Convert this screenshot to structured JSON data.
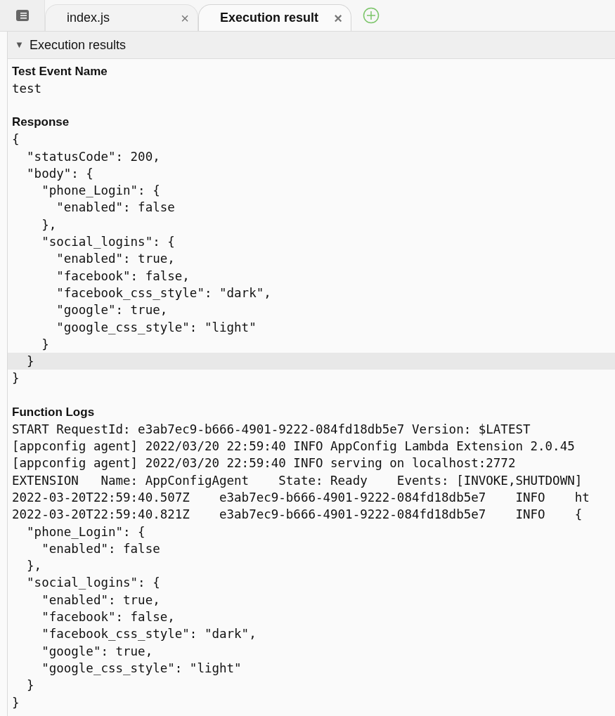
{
  "tabs": [
    {
      "label": "index.js",
      "selected": false,
      "close": "×"
    },
    {
      "label": "Execution result",
      "selected": true,
      "close": "×"
    }
  ],
  "panel": {
    "arrow": "▼",
    "title": "Execution results",
    "expanded": true
  },
  "sections": [
    {
      "heading": "Test Event Name",
      "lines": [
        {
          "text": "test",
          "current": false
        }
      ]
    },
    {
      "heading": "Response",
      "lines": [
        {
          "text": "{",
          "current": false
        },
        {
          "text": "  \"statusCode\": 200,",
          "current": false
        },
        {
          "text": "  \"body\": {",
          "current": false
        },
        {
          "text": "    \"phone_Login\": {",
          "current": false
        },
        {
          "text": "      \"enabled\": false",
          "current": false
        },
        {
          "text": "    },",
          "current": false
        },
        {
          "text": "    \"social_logins\": {",
          "current": false
        },
        {
          "text": "      \"enabled\": true,",
          "current": false
        },
        {
          "text": "      \"facebook\": false,",
          "current": false
        },
        {
          "text": "      \"facebook_css_style\": \"dark\",",
          "current": false
        },
        {
          "text": "      \"google\": true,",
          "current": false
        },
        {
          "text": "      \"google_css_style\": \"light\"",
          "current": false
        },
        {
          "text": "    }",
          "current": false
        },
        {
          "text": "  }",
          "current": true
        },
        {
          "text": "}",
          "current": false
        }
      ]
    },
    {
      "heading": "Function Logs",
      "lines": [
        {
          "text": "START RequestId: e3ab7ec9-b666-4901-9222-084fd18db5e7 Version: $LATEST",
          "current": false
        },
        {
          "text": "[appconfig agent] 2022/03/20 22:59:40 INFO AppConfig Lambda Extension 2.0.45",
          "current": false
        },
        {
          "text": "[appconfig agent] 2022/03/20 22:59:40 INFO serving on localhost:2772",
          "current": false
        },
        {
          "text": "EXTENSION   Name: AppConfigAgent    State: Ready    Events: [INVOKE,SHUTDOWN]",
          "current": false
        },
        {
          "text": "2022-03-20T22:59:40.507Z    e3ab7ec9-b666-4901-9222-084fd18db5e7    INFO    ht",
          "current": false
        },
        {
          "text": "2022-03-20T22:59:40.821Z    e3ab7ec9-b666-4901-9222-084fd18db5e7    INFO    {",
          "current": false
        },
        {
          "text": "  \"phone_Login\": {",
          "current": false
        },
        {
          "text": "    \"enabled\": false",
          "current": false
        },
        {
          "text": "  },",
          "current": false
        },
        {
          "text": "  \"social_logins\": {",
          "current": false
        },
        {
          "text": "    \"enabled\": true,",
          "current": false
        },
        {
          "text": "    \"facebook\": false,",
          "current": false
        },
        {
          "text": "    \"facebook_css_style\": \"dark\",",
          "current": false
        },
        {
          "text": "    \"google\": true,",
          "current": false
        },
        {
          "text": "    \"google_css_style\": \"light\"",
          "current": false
        },
        {
          "text": "  }",
          "current": false
        },
        {
          "text": "}",
          "current": false
        }
      ]
    }
  ]
}
